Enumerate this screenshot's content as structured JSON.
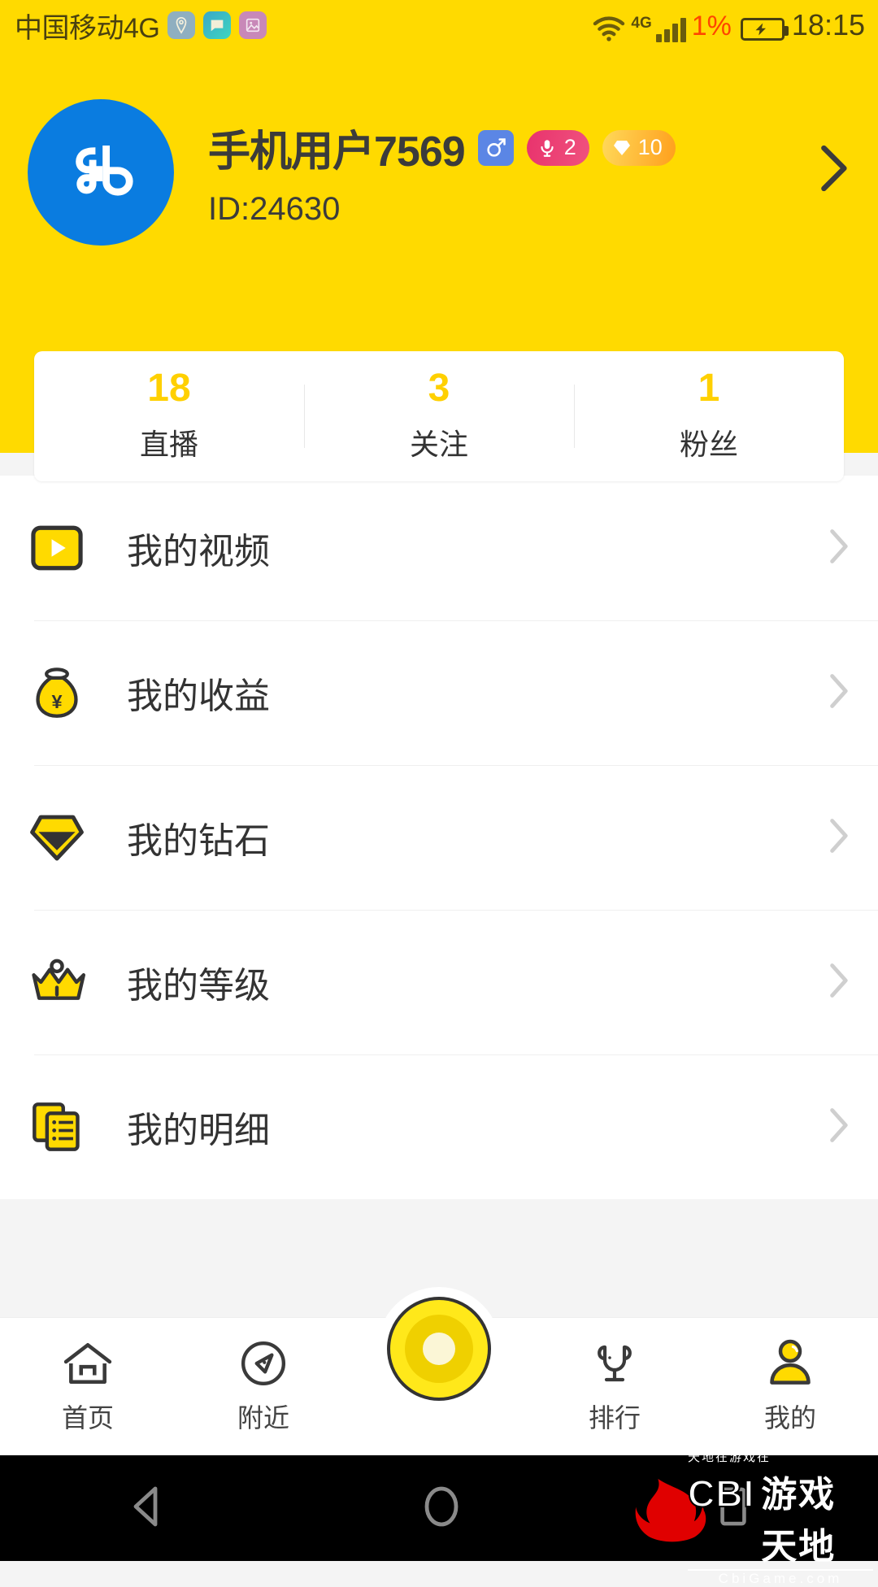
{
  "statusbar": {
    "carrier": "中国移动4G",
    "app_icons": [
      "location-pin-icon",
      "chat-bubble-icon",
      "photo-icon"
    ],
    "wifi_icon": "wifi-icon",
    "network_label": "4G",
    "signal_icon": "signal-bars-icon",
    "battery_percent": "1%",
    "battery_icon": "battery-charging-icon",
    "clock": "18:15",
    "accent_yellow": "#FFDA00",
    "battery_color": "#FF4500"
  },
  "profile": {
    "avatar_icon": "app-logo-avatar",
    "username": "手机用户7569",
    "user_id": "ID:24630",
    "badges": [
      {
        "name": "gender-badge",
        "icon": "male-icon",
        "value": "",
        "color": "#5B86E5"
      },
      {
        "name": "mic-level-badge",
        "icon": "microphone-icon",
        "value": "2",
        "color": "#E8336D"
      },
      {
        "name": "diamond-level-badge",
        "icon": "diamond-icon",
        "value": "10",
        "color": "#FF9F1C"
      }
    ],
    "chevron_icon": "chevron-right-icon"
  },
  "stats": [
    {
      "value": "18",
      "label": "直播",
      "name": "stat-live"
    },
    {
      "value": "3",
      "label": "关注",
      "name": "stat-following"
    },
    {
      "value": "1",
      "label": "粉丝",
      "name": "stat-fans"
    }
  ],
  "menu": [
    {
      "label": "我的视频",
      "icon": "video-icon",
      "name": "menu-item-my-videos"
    },
    {
      "label": "我的收益",
      "icon": "money-bag-icon",
      "name": "menu-item-my-earnings"
    },
    {
      "label": "我的钻石",
      "icon": "diamond-icon",
      "name": "menu-item-my-diamonds"
    },
    {
      "label": "我的等级",
      "icon": "crown-icon",
      "name": "menu-item-my-level"
    },
    {
      "label": "我的明细",
      "icon": "documents-icon",
      "name": "menu-item-my-details"
    }
  ],
  "tabbar": {
    "items": [
      {
        "label": "首页",
        "icon": "home-icon",
        "name": "tab-home",
        "active": false
      },
      {
        "label": "附近",
        "icon": "compass-icon",
        "name": "tab-nearby",
        "active": false
      },
      {
        "label": "排行",
        "icon": "microphone-icon",
        "name": "tab-ranking",
        "active": false
      },
      {
        "label": "我的",
        "icon": "person-icon",
        "name": "tab-mine",
        "active": true
      }
    ],
    "record_button": "record-live-button"
  },
  "androidnav": {
    "back_icon": "back-triangle-icon",
    "home_icon": "home-circle-icon",
    "recents_icon": "recents-square-icon"
  },
  "watermark": {
    "tagline": "天地在游戏在",
    "brand": "CBI",
    "brand_cn": "游戏天地",
    "url": "CbiGame.com"
  }
}
